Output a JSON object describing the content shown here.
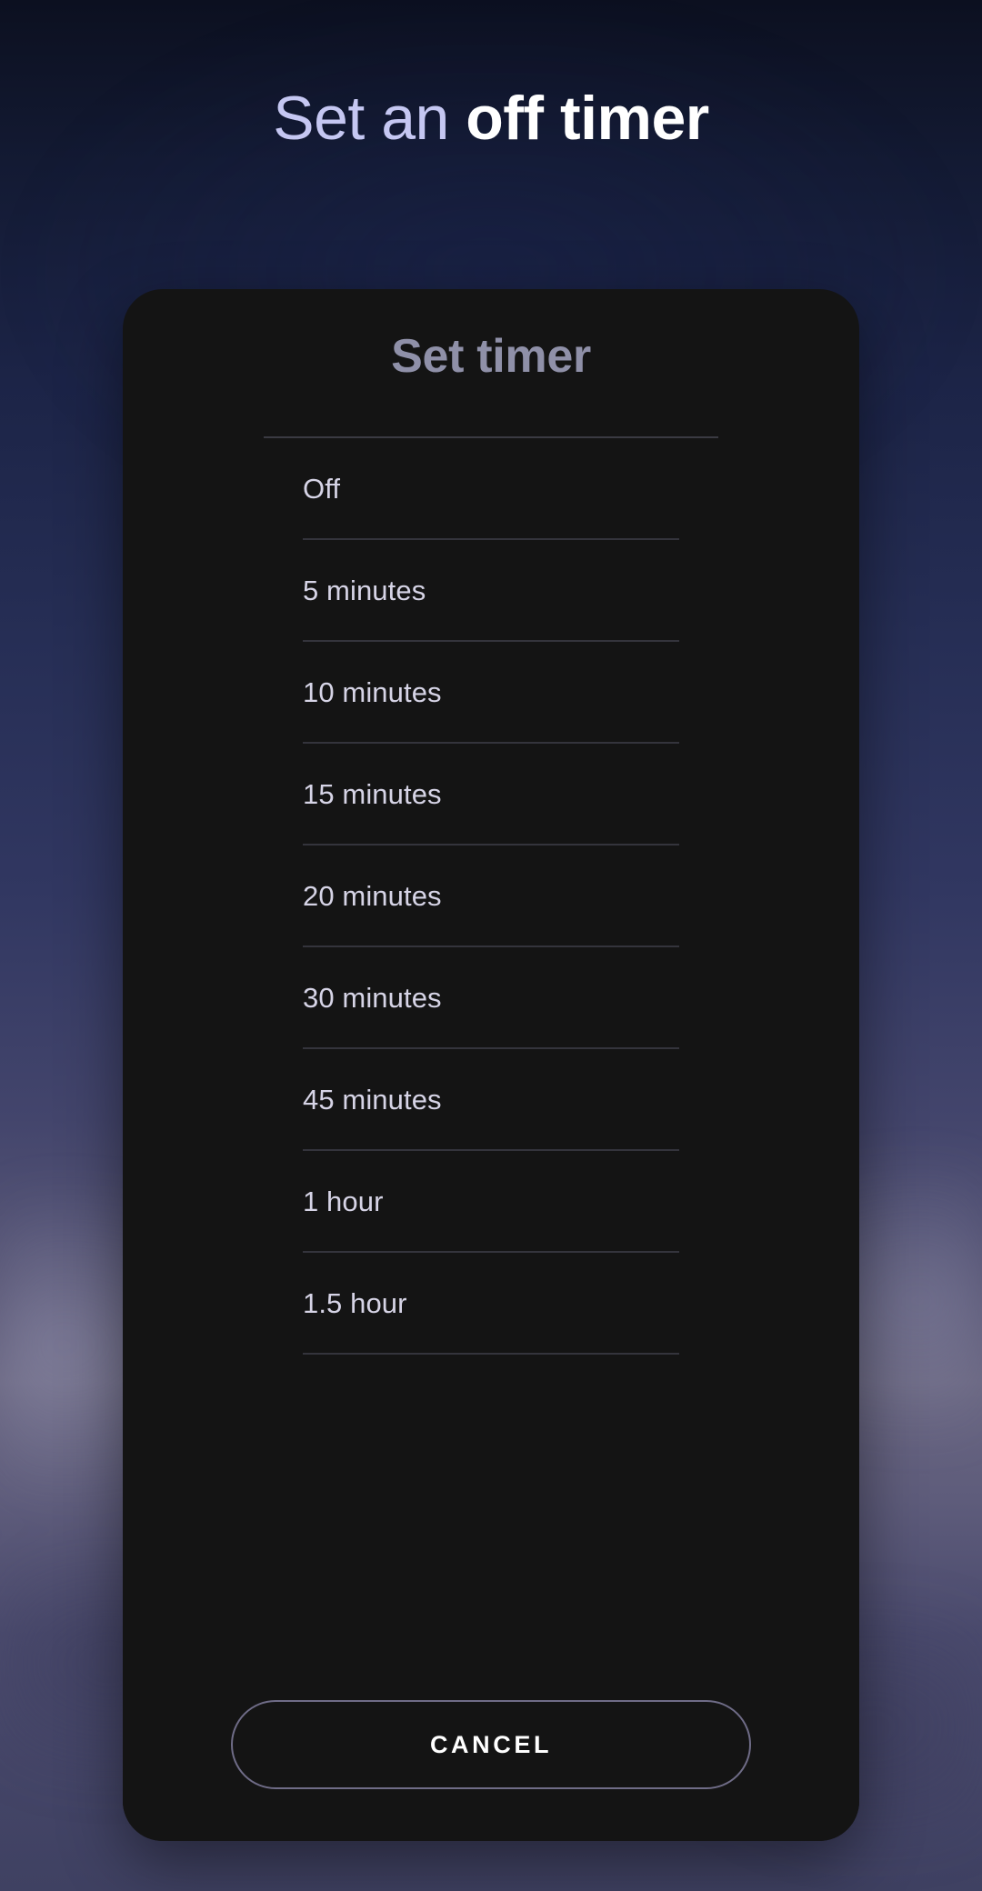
{
  "page": {
    "header": {
      "text_thin": "Set an ",
      "text_bold": "off timer"
    },
    "background": {
      "top_color": "#0c1020",
      "mid_color": "#313761",
      "glow_color": "#6a6782",
      "bottom_color": "#3f4162"
    }
  },
  "dialog": {
    "title": "Set timer",
    "title_color": "#8f90a8",
    "card_color": "#141414",
    "divider_color": "#34343c",
    "option_text_color": "#d6d4e6",
    "options": [
      {
        "label": "Off",
        "value": "off"
      },
      {
        "label": "5 minutes",
        "value": "5m"
      },
      {
        "label": "10 minutes",
        "value": "10m"
      },
      {
        "label": "15 minutes",
        "value": "15m"
      },
      {
        "label": "20 minutes",
        "value": "20m"
      },
      {
        "label": "30 minutes",
        "value": "30m"
      },
      {
        "label": "45 minutes",
        "value": "45m"
      },
      {
        "label": "1 hour",
        "value": "1h"
      },
      {
        "label": "1.5 hour",
        "value": "1.5h"
      }
    ],
    "cancel": {
      "label": "CANCEL",
      "border_color": "#6f6c87",
      "text_color": "#ffffff"
    }
  }
}
